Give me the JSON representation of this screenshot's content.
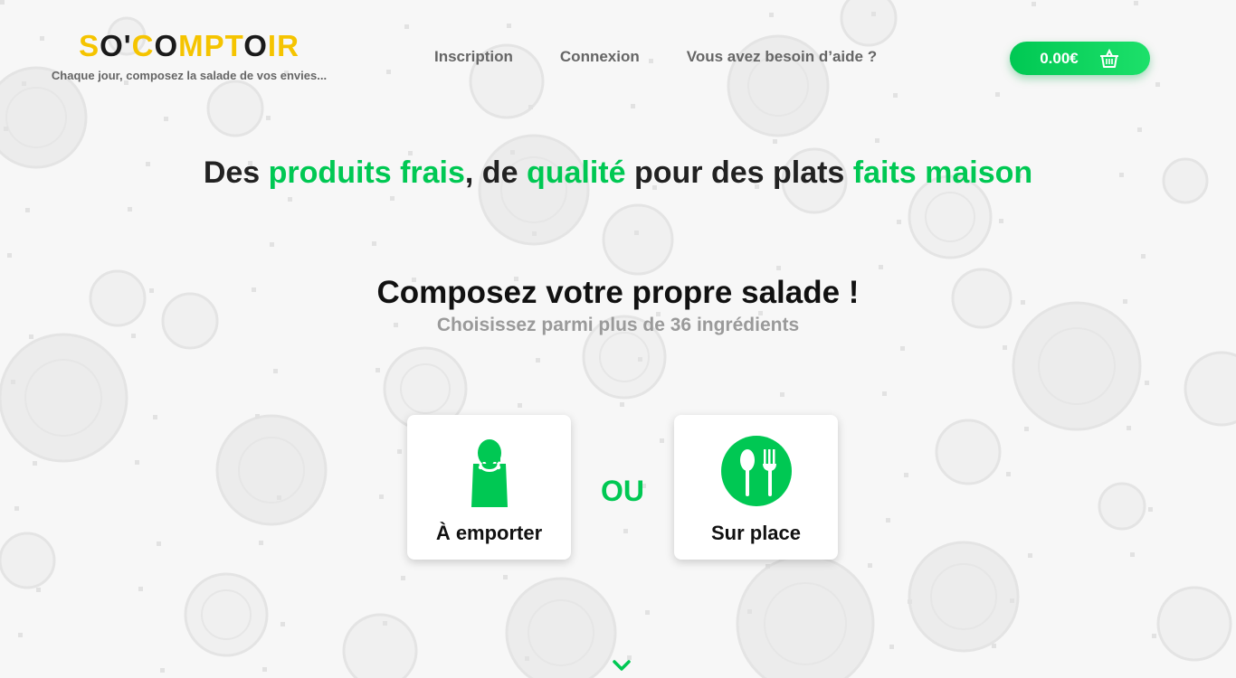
{
  "header": {
    "logo": {
      "letters": [
        {
          "ch": "S",
          "color": "#f5c400"
        },
        {
          "ch": "O",
          "color": "#1a1a1a"
        },
        {
          "ch": "'",
          "color": "#1a1a1a"
        },
        {
          "ch": "C",
          "color": "#f5c400"
        },
        {
          "ch": "O",
          "color": "#1a1a1a"
        },
        {
          "ch": "M",
          "color": "#f5c400"
        },
        {
          "ch": "P",
          "color": "#f5c400"
        },
        {
          "ch": "T",
          "color": "#f5c400"
        },
        {
          "ch": "O",
          "color": "#1a1a1a"
        },
        {
          "ch": "I",
          "color": "#f5c400"
        },
        {
          "ch": "R",
          "color": "#f5c400"
        }
      ],
      "tagline": "Chaque jour, composez la salade de vos envies..."
    },
    "nav": [
      {
        "label": "Inscription",
        "name": "nav-inscription"
      },
      {
        "label": "Connexion",
        "name": "nav-connexion"
      },
      {
        "label": "Vous avez besoin d’aide ?",
        "name": "nav-aide"
      }
    ],
    "cart": {
      "amount": "0.00€",
      "icon": "basket-icon"
    }
  },
  "hero": {
    "headline": [
      {
        "text": "Des ",
        "green": false
      },
      {
        "text": "produits frais",
        "green": true
      },
      {
        "text": ", de ",
        "green": false
      },
      {
        "text": "qualité",
        "green": true
      },
      {
        "text": " pour des plats ",
        "green": false
      },
      {
        "text": "faits maison",
        "green": true
      }
    ],
    "compose_title": "Composez votre propre salade !",
    "compose_subtitle": "Choisissez parmi plus de 36 ingrédients"
  },
  "options": {
    "takeaway": {
      "label": "À emporter",
      "icon": "shopping-bag-icon"
    },
    "separator": "OU",
    "onsite": {
      "label": "Sur place",
      "icon": "spoon-fork-icon"
    }
  },
  "scroll": {
    "icon": "chevron-down-icon"
  },
  "colors": {
    "accent": "#00c853",
    "logo_yellow": "#f5c400",
    "nav_text": "#666666",
    "subtitle": "#9a9a9a"
  }
}
